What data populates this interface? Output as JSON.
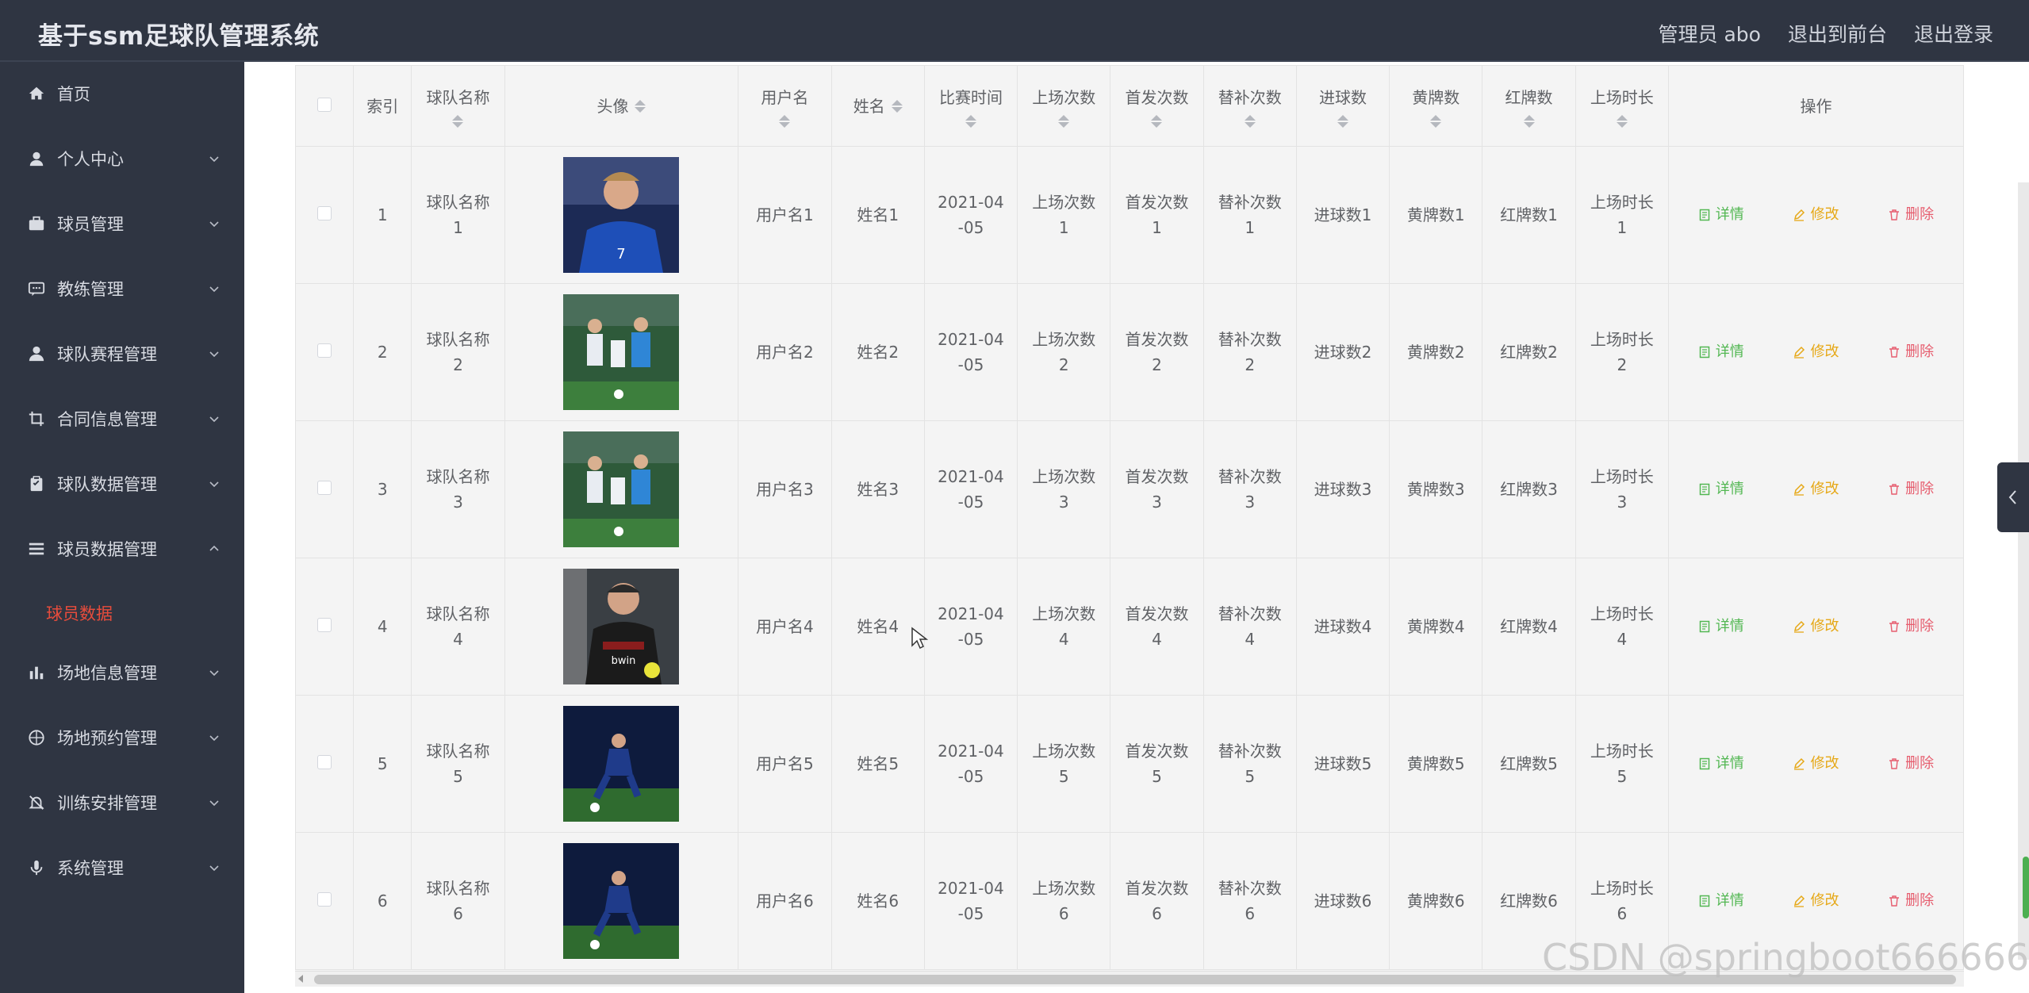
{
  "app": {
    "title": "基于ssm足球队管理系统"
  },
  "header": {
    "user_label": "管理员 abo",
    "front_label": "退出到前台",
    "logout_label": "退出登录"
  },
  "sidebar": {
    "items": [
      {
        "label": "首页",
        "icon": "home-icon"
      },
      {
        "label": "个人中心",
        "icon": "user-icon"
      },
      {
        "label": "球员管理",
        "icon": "briefcase-icon"
      },
      {
        "label": "教练管理",
        "icon": "chat-icon"
      },
      {
        "label": "球队赛程管理",
        "icon": "person-icon"
      },
      {
        "label": "合同信息管理",
        "icon": "crop-icon"
      },
      {
        "label": "球队数据管理",
        "icon": "clipboard-icon"
      },
      {
        "label": "球员数据管理",
        "icon": "list-icon",
        "expanded": true
      },
      {
        "label": "场地信息管理",
        "icon": "bar-chart-icon"
      },
      {
        "label": "场地预约管理",
        "icon": "compass-icon"
      },
      {
        "label": "训练安排管理",
        "icon": "bell-off-icon"
      },
      {
        "label": "系统管理",
        "icon": "mic-icon"
      }
    ],
    "sub_active": "球员数据",
    "active_color": "#e74c3c"
  },
  "table": {
    "headers": {
      "index": "索引",
      "team": "球队名称",
      "avatar": "头像",
      "username": "用户名",
      "name": "姓名",
      "match_time": "比赛时间",
      "appearances": "上场次数",
      "starts": "首发次数",
      "subs": "替补次数",
      "goals": "进球数",
      "yellow": "黄牌数",
      "red": "红牌数",
      "minutes": "上场时长",
      "ops": "操作"
    },
    "actions": {
      "detail": "详情",
      "edit": "修改",
      "delete": "删除"
    },
    "rows": [
      {
        "index": "1",
        "team_a": "球队名称",
        "team_b": "1",
        "username": "用户名1",
        "name": "姓名1",
        "time_a": "2021-04",
        "time_b": "-05",
        "app_a": "上场次数",
        "app_b": "1",
        "start_a": "首发次数",
        "start_b": "1",
        "sub_a": "替补次数",
        "sub_b": "1",
        "goals": "进球数1",
        "yellow": "黄牌数1",
        "red": "红牌数1",
        "min_a": "上场时长",
        "min_b": "1"
      },
      {
        "index": "2",
        "team_a": "球队名称",
        "team_b": "2",
        "username": "用户名2",
        "name": "姓名2",
        "time_a": "2021-04",
        "time_b": "-05",
        "app_a": "上场次数",
        "app_b": "2",
        "start_a": "首发次数",
        "start_b": "2",
        "sub_a": "替补次数",
        "sub_b": "2",
        "goals": "进球数2",
        "yellow": "黄牌数2",
        "red": "红牌数2",
        "min_a": "上场时长",
        "min_b": "2"
      },
      {
        "index": "3",
        "team_a": "球队名称",
        "team_b": "3",
        "username": "用户名3",
        "name": "姓名3",
        "time_a": "2021-04",
        "time_b": "-05",
        "app_a": "上场次数",
        "app_b": "3",
        "start_a": "首发次数",
        "start_b": "3",
        "sub_a": "替补次数",
        "sub_b": "3",
        "goals": "进球数3",
        "yellow": "黄牌数3",
        "red": "红牌数3",
        "min_a": "上场时长",
        "min_b": "3"
      },
      {
        "index": "4",
        "team_a": "球队名称",
        "team_b": "4",
        "username": "用户名4",
        "name": "姓名4",
        "time_a": "2021-04",
        "time_b": "-05",
        "app_a": "上场次数",
        "app_b": "4",
        "start_a": "首发次数",
        "start_b": "4",
        "sub_a": "替补次数",
        "sub_b": "4",
        "goals": "进球数4",
        "yellow": "黄牌数4",
        "red": "红牌数4",
        "min_a": "上场时长",
        "min_b": "4"
      },
      {
        "index": "5",
        "team_a": "球队名称",
        "team_b": "5",
        "username": "用户名5",
        "name": "姓名5",
        "time_a": "2021-04",
        "time_b": "-05",
        "app_a": "上场次数",
        "app_b": "5",
        "start_a": "首发次数",
        "start_b": "5",
        "sub_a": "替补次数",
        "sub_b": "5",
        "goals": "进球数5",
        "yellow": "黄牌数5",
        "red": "红牌数5",
        "min_a": "上场时长",
        "min_b": "5"
      },
      {
        "index": "6",
        "team_a": "球队名称",
        "team_b": "6",
        "username": "用户名6",
        "name": "姓名6",
        "time_a": "2021-04",
        "time_b": "-05",
        "app_a": "上场次数",
        "app_b": "6",
        "start_a": "首发次数",
        "start_b": "6",
        "sub_a": "替补次数",
        "sub_b": "6",
        "goals": "进球数6",
        "yellow": "黄牌数6",
        "red": "红牌数6",
        "min_a": "上场时长",
        "min_b": "6"
      }
    ]
  },
  "watermark": "CSDN @springboot666666"
}
